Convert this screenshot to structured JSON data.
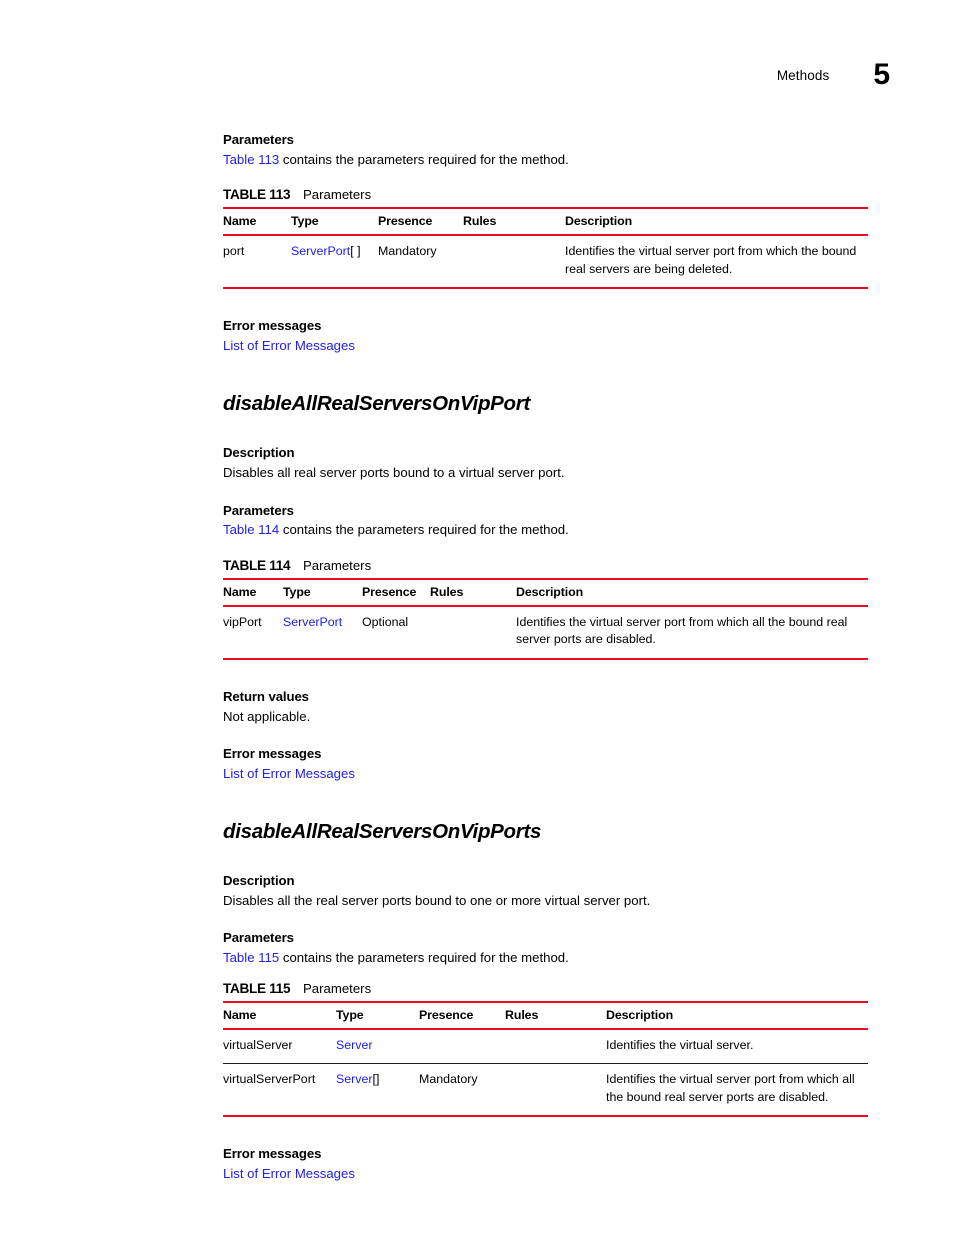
{
  "header": {
    "label": "Methods",
    "chapter": "5"
  },
  "colors": {
    "rule_red": "#ED0A22",
    "link_blue": "#2020E8"
  },
  "labels": {
    "parameters": "Parameters",
    "description": "Description",
    "error_messages": "Error messages",
    "return_values": "Return values",
    "error_link": "List of Error Messages",
    "table_title": "Parameters"
  },
  "table_columns": [
    "Name",
    "Type",
    "Presence",
    "Rules",
    "Description"
  ],
  "sections": [
    {
      "id": "section-top",
      "parameters_heading": "Parameters",
      "parameters_intro_link": "Table 113",
      "parameters_intro_text": " contains the parameters required for the method.",
      "table": {
        "number": "TABLE 113",
        "title": "Parameters",
        "columns": [
          "Name",
          "Type",
          "Presence",
          "Rules",
          "Description"
        ],
        "rows": [
          {
            "name": "port",
            "type_link": "ServerPort",
            "type_suffix": "[ ]",
            "presence": "Mandatory",
            "rules": "",
            "description": "Identifies the virtual server port from which the bound real servers are being deleted."
          }
        ]
      },
      "error_heading": "Error messages",
      "error_link": "List of Error Messages"
    },
    {
      "id": "section-disable-all-real-servers-on-vip-port",
      "method_name": "disableAllRealServersOnVipPort",
      "description_heading": "Description",
      "description_text": "Disables all real server ports bound to a virtual server port.",
      "parameters_heading": "Parameters",
      "parameters_intro_link": "Table 114",
      "parameters_intro_text": " contains the parameters required for the method.",
      "table": {
        "number": "TABLE 114",
        "title": "Parameters",
        "columns": [
          "Name",
          "Type",
          "Presence",
          "Rules",
          "Description"
        ],
        "rows": [
          {
            "name": "vipPort",
            "type_link": "ServerPort",
            "type_suffix": "",
            "presence": "Optional",
            "rules": "",
            "description": "Identifies the virtual server port from which all the bound real server ports are disabled."
          }
        ]
      },
      "return_heading": "Return values",
      "return_text": "Not applicable.",
      "error_heading": "Error messages",
      "error_link": "List of Error Messages"
    },
    {
      "id": "section-disable-all-real-servers-on-vip-ports",
      "method_name": "disableAllRealServersOnVipPorts",
      "description_heading": "Description",
      "description_text": "Disables all the real server ports bound to one or more virtual server port.",
      "parameters_heading": "Parameters",
      "parameters_intro_link": "Table 115",
      "parameters_intro_text": " contains the parameters required for the method.",
      "table": {
        "number": "TABLE 115",
        "title": "Parameters",
        "columns": [
          "Name",
          "Type",
          "Presence",
          "Rules",
          "Description"
        ],
        "rows": [
          {
            "name": "virtualServer",
            "type_link": "Server",
            "type_suffix": "",
            "presence": "",
            "rules": "",
            "description": "Identifies the virtual server."
          },
          {
            "name": "virtualServerPort",
            "type_link": "Server",
            "type_suffix": "[]",
            "presence": "Mandatory",
            "rules": "",
            "description": "Identifies the virtual server port from which all the bound real server ports are disabled."
          }
        ]
      },
      "error_heading": "Error messages",
      "error_link": "List of Error Messages"
    }
  ]
}
